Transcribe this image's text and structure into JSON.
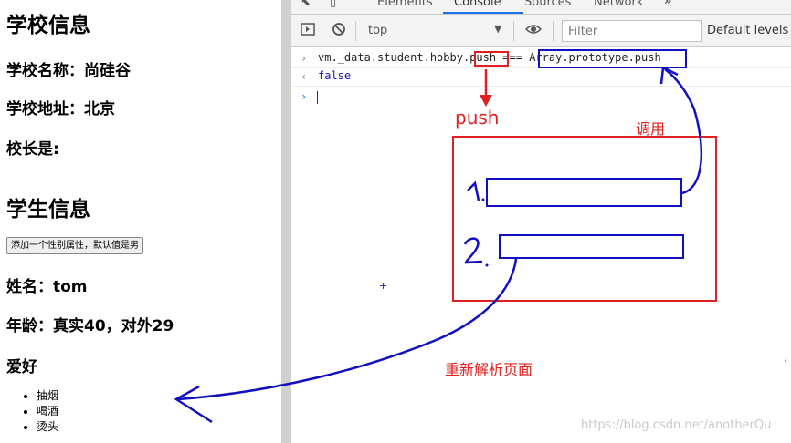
{
  "left_page": {
    "school_heading": "学校信息",
    "school_name": "学校名称：尚硅谷",
    "school_address": "学校地址：北京",
    "principal": "校长是:",
    "student_heading": "学生信息",
    "add_button": "添加一个性别属性，默认值是男",
    "student_name": "姓名：tom",
    "student_age": "年龄：真实40，对外29",
    "hobby_heading": "爱好",
    "hobbies": [
      "抽烟",
      "喝酒",
      "烫头"
    ]
  },
  "devtools": {
    "tabs": [
      "Elements",
      "Console",
      "Sources",
      "Network"
    ],
    "active_tab": "Console",
    "more_tabs_icon": "»",
    "context": "top",
    "filter_placeholder": "Filter",
    "levels": "Default levels",
    "console": {
      "code_prefix": "vm._data.student.hobby.",
      "code_push": "push",
      "code_op": " === ",
      "code_proto": "Array.prototype.push",
      "result": "false"
    }
  },
  "annotations": {
    "push_label": "push",
    "call_label": "调用",
    "reparse_label": "重新解析页面",
    "step1": "1.",
    "step2": "2."
  },
  "watermark": "https://blog.csdn.net/anotherQu",
  "colors": {
    "annotation_red": "#e02020",
    "annotation_blue": "#1010c0",
    "accent": "#1a73e8"
  }
}
